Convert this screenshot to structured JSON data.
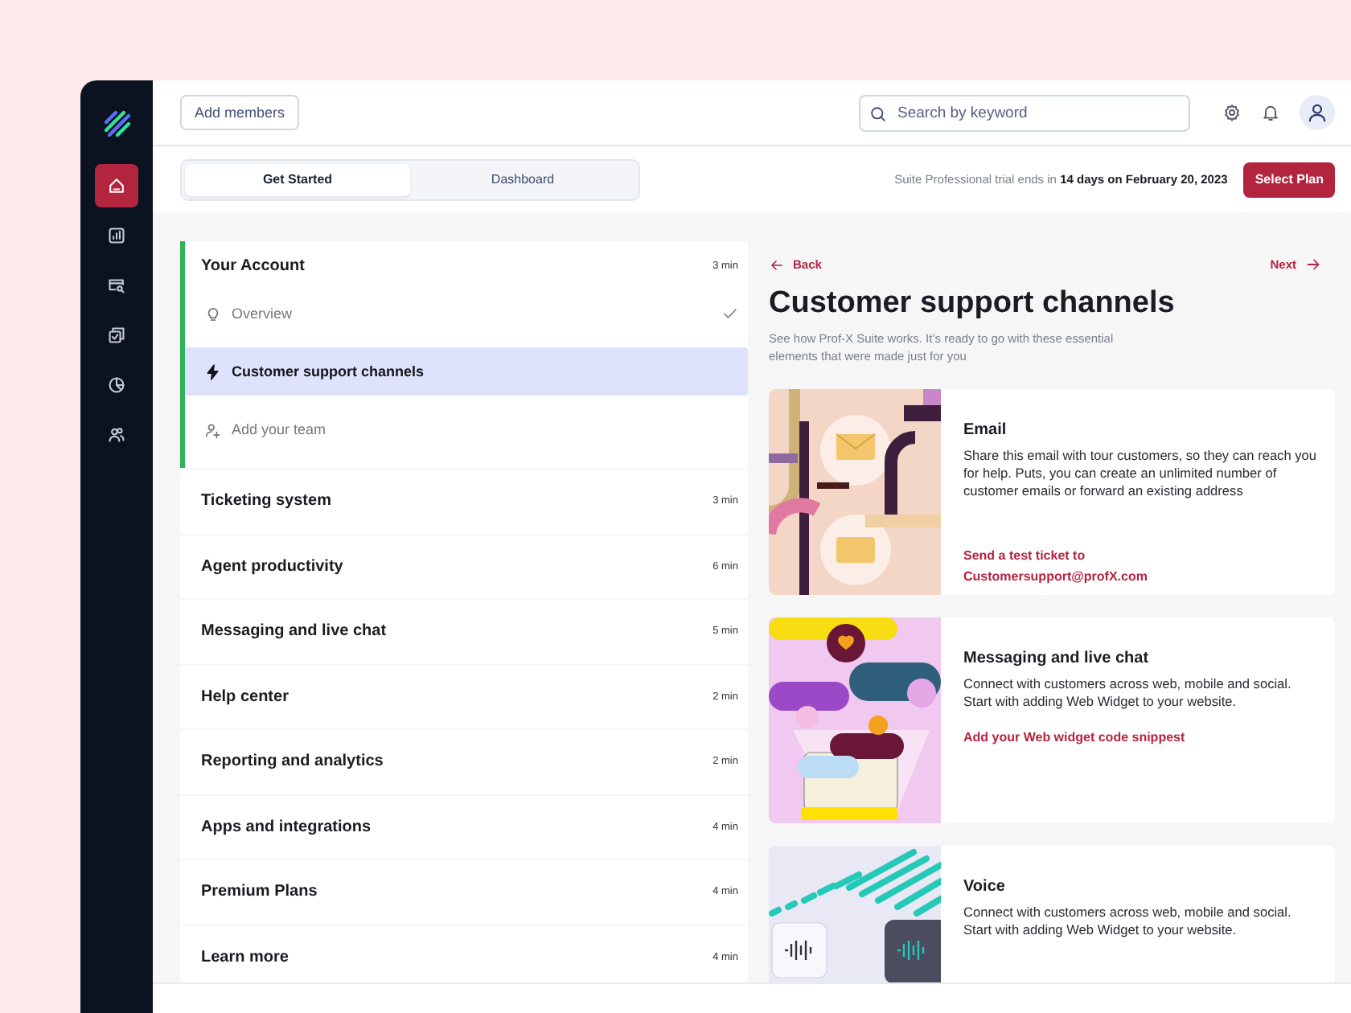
{
  "sidebar": {
    "items": [
      {
        "selected": true
      },
      {
        "selected": false
      },
      {
        "selected": false
      },
      {
        "selected": false
      },
      {
        "selected": false
      },
      {
        "selected": false
      }
    ]
  },
  "top_bar": {
    "add_members": "Add members",
    "search": {
      "placeholder": "Search by keyword"
    }
  },
  "tabs": [
    {
      "label": "Get Started",
      "selected": true
    },
    {
      "label": "Dashboard",
      "selected": false
    }
  ],
  "trial_notice": "Suite Professional trial ends in **14 days on February 20, 2023**",
  "select_plan": "Select Plan",
  "sections": [
    {
      "title": "Your Account",
      "duration": "3 min",
      "expanded": true,
      "steps": [
        {
          "label": "Overview",
          "done": true,
          "selected": false
        },
        {
          "label": "Customer support channels",
          "done": false,
          "selected": true
        },
        {
          "label": "Add your team",
          "done": false,
          "selected": false
        }
      ]
    },
    {
      "title": "Ticketing system",
      "duration": "3 min",
      "expanded": false
    },
    {
      "title": "Agent productivity",
      "duration": "6 min",
      "expanded": false
    },
    {
      "title": "Messaging and live chat",
      "duration": "5 min",
      "expanded": false
    },
    {
      "title": "Help center",
      "duration": "2 min",
      "expanded": false
    },
    {
      "title": "Reporting and analytics",
      "duration": "2 min",
      "expanded": false
    },
    {
      "title": "Apps and integrations",
      "duration": "4 min",
      "expanded": false
    },
    {
      "title": "Premium Plans",
      "duration": "4 min",
      "expanded": false
    },
    {
      "title": "Learn more",
      "duration": "4 min",
      "expanded": false
    }
  ],
  "detail": {
    "back": "Back",
    "next": "Next",
    "title": "Customer support channels",
    "subtitle": "See how Prof-X Suite works. It’s ready to go with these essential elements that were made just for you",
    "cards": [
      {
        "kind": "email",
        "title": "Email",
        "description": "Share this email with tour customers, so they can reach you for help. Puts, you can create an unlimited number of customer emails or forward an existing address",
        "links": [
          "Send a test ticket to",
          "Customersupport@profX.com"
        ]
      },
      {
        "kind": "chat",
        "title": "Messaging and live chat",
        "description": "Connect with customers across web, mobile and social. Start with adding Web Widget to your website.",
        "links": [
          "Add your Web widget code snippest"
        ]
      },
      {
        "kind": "voice",
        "title": "Voice",
        "description": "Connect with customers across web, mobile and social. Start with adding Web Widget to your website."
      }
    ]
  }
}
